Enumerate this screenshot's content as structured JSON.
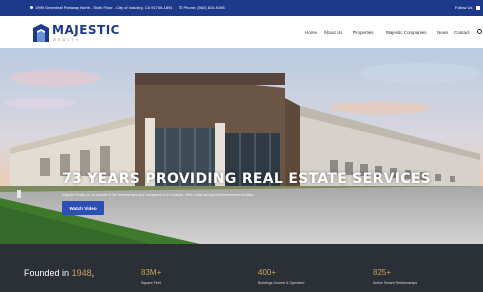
{
  "topbar": {
    "address": "1999 Greenleaf Parkway North - Sixth Floor - City of Industry, CA 91746-1891",
    "phone": "Phone: (562) 810-9198",
    "follow": "Follow Us"
  },
  "logo": {
    "name": "MAJESTIC",
    "sub": "REALTY"
  },
  "nav": {
    "items": [
      "Home",
      "About Us",
      "Properties",
      "Majestic Companies",
      "News",
      "Contact"
    ]
  },
  "hero": {
    "title": "73 YEARS PROVIDING REAL ESTATE SERVICES",
    "subtitle": "Majestic Realty Co. is a leader in the development and management of industrial, office, retail and sports/entertainment facilities",
    "button": "Watch Video"
  },
  "stats": {
    "founded_prefix": "Founded in",
    "founded_year": "1948",
    "items": [
      {
        "value": "83M+",
        "label": "Square Feet"
      },
      {
        "value": "400+",
        "label": "Buildings Owned & Operated"
      },
      {
        "value": "825+",
        "label": "Active Tenant Relationships"
      }
    ]
  },
  "colors": {
    "brand_blue": "#1d3a8a",
    "button_blue": "#2c4fb5",
    "accent_gold": "#c9a35a",
    "footer_dark": "#2b2f36"
  }
}
